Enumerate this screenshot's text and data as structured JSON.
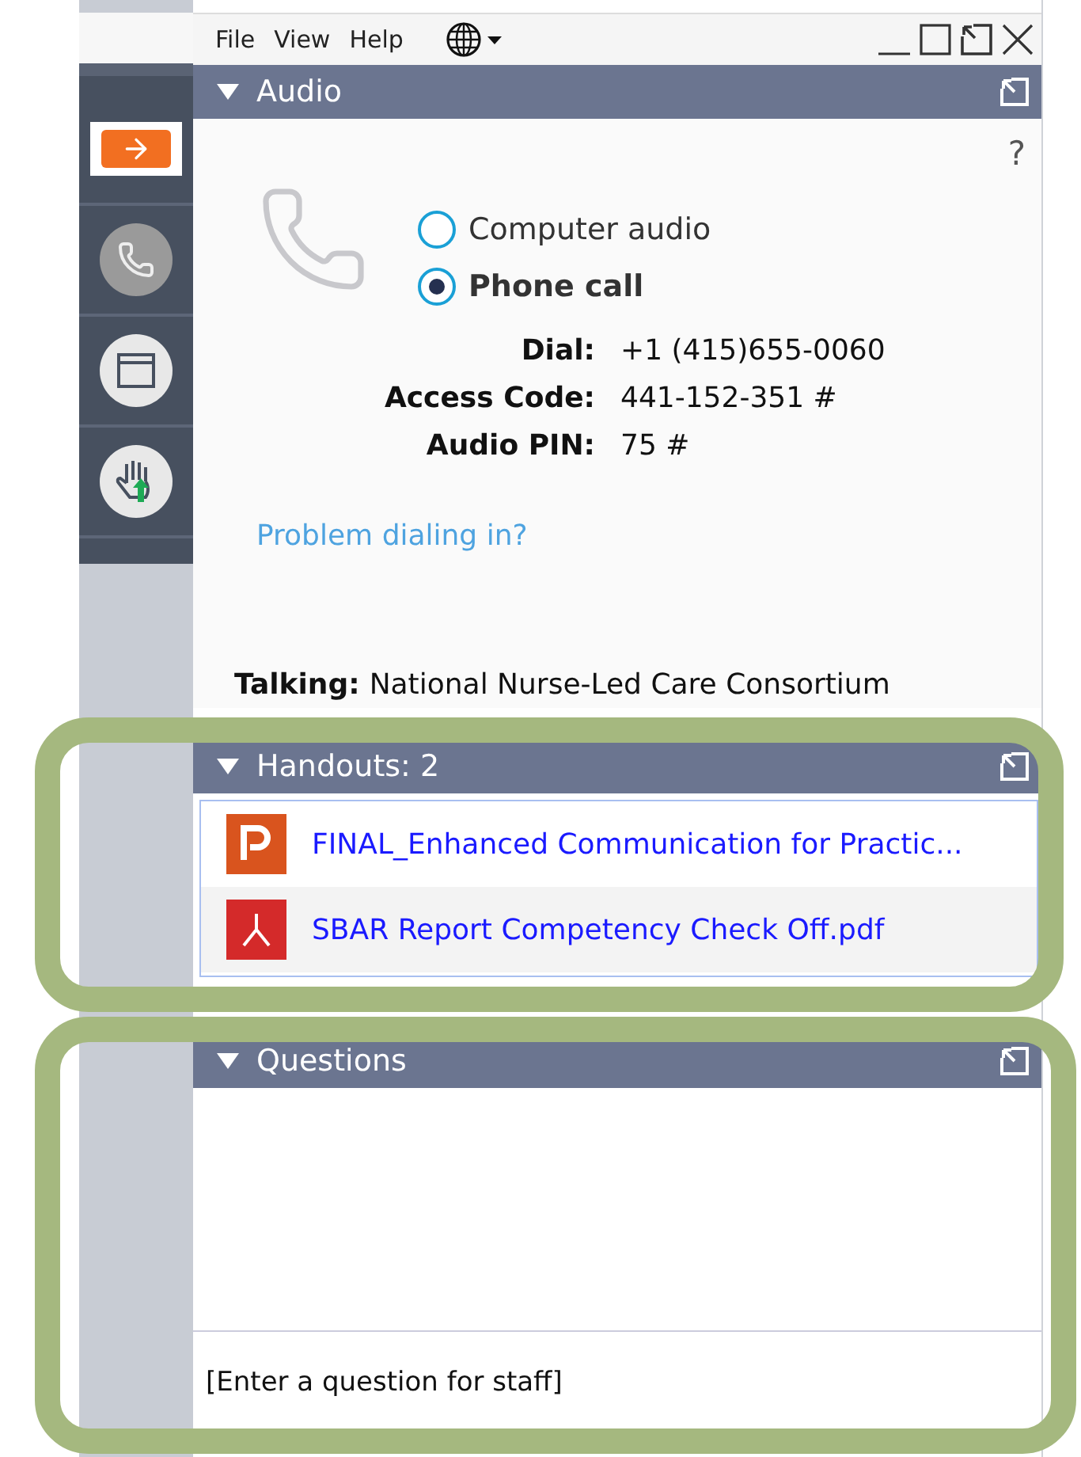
{
  "menu": [
    "File",
    "View",
    "Help"
  ],
  "sidebar": {
    "tools": [
      {
        "kind": "arrow",
        "selected": true
      },
      {
        "kind": "phone",
        "selected": false
      },
      {
        "kind": "window",
        "selected": false
      },
      {
        "kind": "hand",
        "selected": false
      }
    ]
  },
  "audio": {
    "title": "Audio",
    "help": "?",
    "options": [
      {
        "label": "Computer audio",
        "selected": false
      },
      {
        "label": "Phone call",
        "selected": true
      }
    ],
    "details": [
      {
        "label": "Dial:",
        "value": "+1 (415)655-0060"
      },
      {
        "label": "Access Code:",
        "value": "441-152-351 #"
      },
      {
        "label": "Audio PIN:",
        "value": "75 #"
      }
    ],
    "link": "Problem dialing in?",
    "talking": {
      "label": "Talking:",
      "value": "National Nurse-Led Care Consortium"
    }
  },
  "handouts": {
    "title": "Handouts: 2",
    "items": [
      {
        "kind": "powerpoint",
        "name": "FINAL_Enhanced Communication for Practic..."
      },
      {
        "kind": "pdf",
        "name": "SBAR Report Competency Check Off.pdf"
      }
    ]
  },
  "questions": {
    "title": "Questions",
    "placeholder": "[Enter a question for staff]"
  }
}
